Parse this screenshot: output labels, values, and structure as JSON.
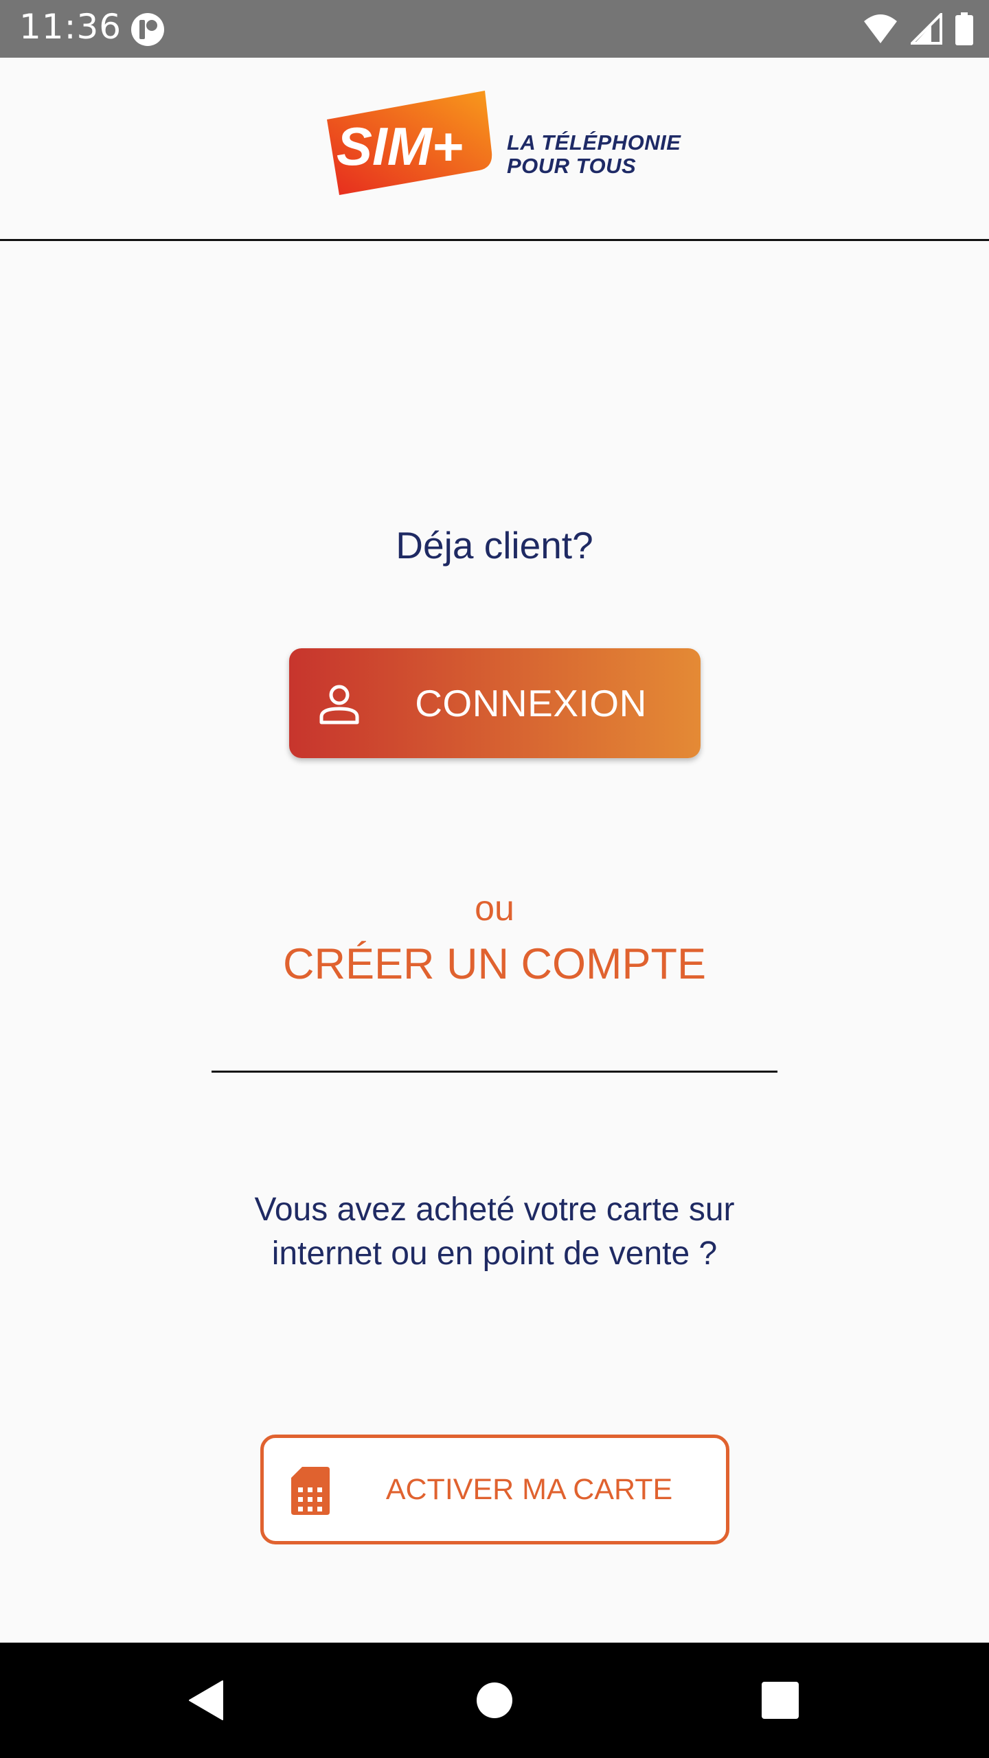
{
  "status_bar": {
    "time": "11:36",
    "icons": [
      "app-notification-icon",
      "wifi-icon",
      "signal-icon",
      "battery-icon"
    ]
  },
  "header": {
    "logo_text": "SIM+",
    "tagline_line1": "LA TÉLÉPHONIE",
    "tagline_line2": "POUR TOUS"
  },
  "main": {
    "already_client": "Déja client?",
    "connexion_label": "CONNEXION",
    "or": "ou",
    "create_account": "CRÉER UN COMPTE",
    "bought_card": "Vous avez acheté votre carte sur internet ou en point de vente ?",
    "activate_label": "ACTIVER MA CARTE"
  },
  "nav_bar": {
    "icons": [
      "back-icon",
      "home-icon",
      "recents-icon"
    ]
  },
  "colors": {
    "brand_orange": "#e0622f",
    "brand_red": "#c7352d",
    "navy_text": "#1f2a63",
    "status_bar": "#757575"
  }
}
